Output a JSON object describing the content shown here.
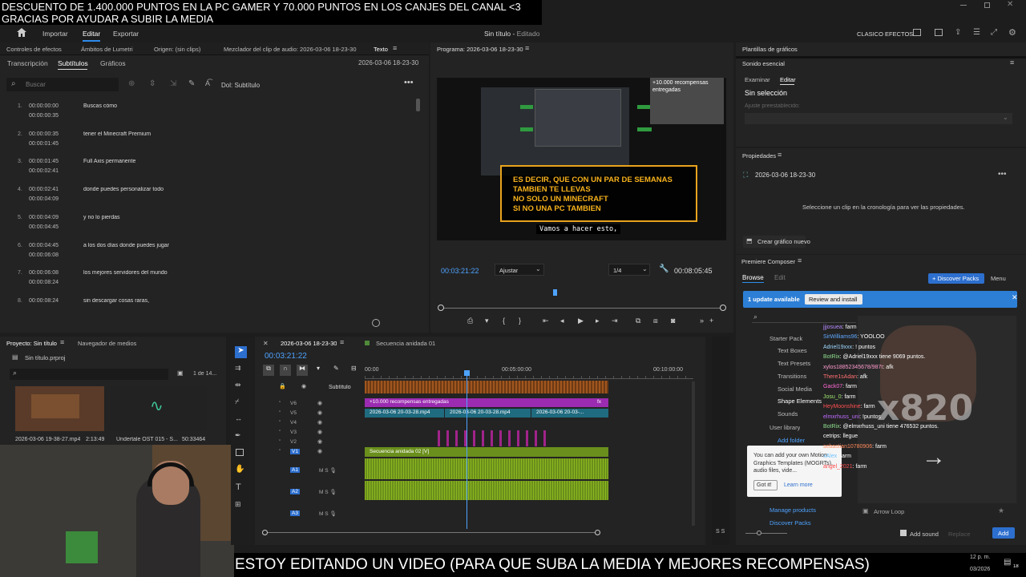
{
  "overlay": {
    "banner_line1": "DESCUENTO DE 1.400.000 PUNTOS EN LA PC GAMER Y 70.000 PUNTOS EN LOS CANJES DEL CANAL <3",
    "banner_line2": "GRACIAS POR AYUDAR A SUBIR LA MEDIA",
    "bottom_caption": "ESTOY EDITANDO UN VIDEO (PARA QUE SUBA LA MEDIA Y MEJORES RECOMPENSAS)",
    "clock_time": "12 p. m.",
    "clock_date": "03/2026",
    "badge": "18",
    "xp": "x820"
  },
  "header": {
    "nav": [
      "Importar",
      "Editar",
      "Exportar"
    ],
    "doc_title": "Sin título",
    "doc_status": "Editado",
    "workspace": "CLASICO EFECTOS"
  },
  "left_tabs": [
    "Controles de efectos",
    "Ámbitos de Lumetri",
    "Origen: (sin clips)",
    "Mezclador del clip de audio: 2026-03-06 18-23-30",
    "Texto"
  ],
  "text_panel": {
    "subtabs": [
      "Transcripción",
      "Subtítulos",
      "Gráficos"
    ],
    "sequence": "2026-03-06 18-23-30",
    "search_placeholder": "Buscar",
    "track": "Dol: Subtítulo",
    "captions": [
      {
        "n": "1.",
        "in": "00:00:00:00",
        "out": "00:00:00:35",
        "text": "Buscas cómo"
      },
      {
        "n": "2.",
        "in": "00:00:00:35",
        "out": "00:00:01:45",
        "text": "tener el Minecraft Premium"
      },
      {
        "n": "3.",
        "in": "00:00:01:45",
        "out": "00:00:02:41",
        "text": "Full Axis permanente"
      },
      {
        "n": "4.",
        "in": "00:00:02:41",
        "out": "00:00:04:09",
        "text": "donde puedes personalizar todo"
      },
      {
        "n": "5.",
        "in": "00:00:04:09",
        "out": "00:00:04:45",
        "text": "y no lo pierdas"
      },
      {
        "n": "6.",
        "in": "00:00:04:45",
        "out": "00:00:06:08",
        "text": "a los dos días donde puedes jugar"
      },
      {
        "n": "7.",
        "in": "00:00:06:08",
        "out": "00:00:08:24",
        "text": "los mejores servidores del mundo"
      },
      {
        "n": "8.",
        "in": "00:00:08:24",
        "out": "",
        "text": "sin descargar cosas raras,"
      }
    ]
  },
  "program": {
    "title": "Programa: 2026-03-06 18-23-30",
    "box_lines": [
      "ES DECIR, QUE CON UN PAR DE SEMANAS",
      "TAMBIEN TE LLEVAS",
      "NO SOLO UN MINECRAFT",
      "SI NO UNA PC TAMBIEN"
    ],
    "subtitle": "Vamos a hacer esto,",
    "reward": "+10.000 recompensas entregadas",
    "timecode": "00:03:21:22",
    "fit": "Ajustar",
    "res": "1/4",
    "duration": "00:08:05:45"
  },
  "right": {
    "graphics_title": "Plantillas de gráficos",
    "essential": "Sonido esencial",
    "tabs": [
      "Examinar",
      "Editar"
    ],
    "no_sel": "Sin selección",
    "preset": "Ajuste preestablecido:",
    "props_title": "Propiedades",
    "props_seq": "2026-03-06 18-23-30",
    "props_hint": "Seleccione un clip en la cronología para ver las propiedades.",
    "new_graphic": "Crear gráfico nuevo",
    "composer": "Premiere Composer",
    "browse": "Browse",
    "edit": "Edit",
    "discover": "Discover Packs",
    "menu": "Menu",
    "update": "1 update available",
    "review": "Review and install",
    "tree": [
      "Starter Pack",
      "Text Boxes",
      "Text Presets",
      "Transitions",
      "Social Media",
      "Shape Elements",
      "Sounds",
      "User library",
      "Add folder",
      "Manage products",
      "Discover Packs"
    ],
    "tooltip": "You can add your own Motion Graphics Templates (MOGRTs), audio files, vide...",
    "got_it": "Got it!",
    "learn": "Learn more",
    "arrow_loop": "Arrow Loop",
    "add_sound": "Add sound",
    "replace": "Replace",
    "add": "Add"
  },
  "chat": [
    {
      "user": "jjjosuea",
      "msg": ": farm",
      "color": "#b68cff"
    },
    {
      "user": "SirWilliams96",
      "msg": ": YOOLOO",
      "color": "#5fa8ff"
    },
    {
      "user": "Adriel19xxx",
      "msg": ": ! puntos",
      "color": "#9fd8ff"
    },
    {
      "user": "BotRix",
      "msg": ": @Adriel19xxx tiene 9069 puntos.",
      "color": "#8fe08f"
    },
    {
      "user": "xylos18852345678/987t",
      "msg": ": afk",
      "color": "#ff9bd0"
    },
    {
      "user": "There1sAdan",
      "msg": ": afk",
      "color": "#ff7070"
    },
    {
      "user": "Gack07",
      "msg": ": farm",
      "color": "#ff6ad5"
    },
    {
      "user": "Josu_0",
      "msg": ": farm",
      "color": "#9fe870"
    },
    {
      "user": "HeyMoonshine",
      "msg": ": farm",
      "color": "#ff5050"
    },
    {
      "user": "elmxrhuss_uni",
      "msg": ": !puntos",
      "color": "#c06bff"
    },
    {
      "user": "BotRix",
      "msg": ": @elmxrhuss_uni tiene 476532 puntos.",
      "color": "#8fe08f"
    },
    {
      "user": "cetrips",
      "msg": ": llegue",
      "color": "#ffffff"
    },
    {
      "user": "sebastian10780906",
      "msg": ": farm",
      "color": "#ff8a5c"
    },
    {
      "user": "xAlex",
      "msg": ": farm",
      "color": "#6ec3ff"
    },
    {
      "user": "angel_2021",
      "msg": ": farm",
      "color": "#ff4d4d"
    }
  ],
  "project": {
    "tab1": "Proyecto: Sin título",
    "tab2": "Navegador de medios",
    "file": "Sin título.prproj",
    "count": "1 de 14...",
    "clip1": "2026-03-06 19-38-27.mp4",
    "clip1_dur": "2:13:49",
    "clip2": "Undertale OST 015 - S...",
    "clip2_dur": "50:33464"
  },
  "timeline": {
    "seq_tab": "2026-03-06 18-23-30",
    "nested_tab": "Secuencia anidada 01",
    "timecode": "00:03:21:22",
    "ruler": [
      "00:00",
      "00:05:00:00",
      "00:10:00:00"
    ],
    "subtitle_track": "Subtítulo",
    "video_tracks": [
      "V6",
      "V5",
      "V4",
      "V3",
      "V2",
      "V1"
    ],
    "audio_tracks": [
      "A1",
      "A2",
      "A3"
    ],
    "clip_reward": "+10.000 recompensas entregadas",
    "clip_v5a": "2026-03-06 20-03-28.mp4",
    "clip_v5b": "2026-03-06 20-03-28.mp4",
    "clip_v5c": "2026-03-06 20-03-...",
    "clip_v1": "Secuencia anidada 02 [V]",
    "fx": "fx"
  }
}
